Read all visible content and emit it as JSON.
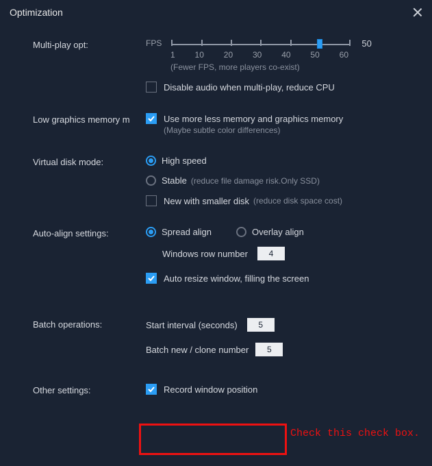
{
  "title": "Optimization",
  "multiplay": {
    "label": "Multi-play opt:",
    "fps_label": "FPS",
    "value": 50,
    "ticks": [
      1,
      10,
      20,
      30,
      40,
      50,
      60
    ],
    "hint": "(Fewer FPS, more players co-exist)",
    "disable_audio": {
      "checked": false,
      "label": "Disable audio when multi-play, reduce CPU"
    }
  },
  "lowgfx": {
    "label": "Low graphics memory m",
    "use_less_mem": {
      "checked": true,
      "label": "Use more less memory and graphics memory"
    },
    "hint": "(Maybe subtle color differences)"
  },
  "vdisk": {
    "label": "Virtual disk mode:",
    "options": {
      "high": {
        "selected": true,
        "label": "High speed"
      },
      "stable": {
        "selected": false,
        "label": "Stable",
        "sub": "(reduce file damage risk.Only SSD)"
      },
      "new_small": {
        "checked": false,
        "label": "New with smaller disk",
        "sub": "(reduce disk space cost)"
      }
    }
  },
  "autoalign": {
    "label": "Auto-align settings:",
    "spread": {
      "selected": true,
      "label": "Spread align"
    },
    "overlay": {
      "selected": false,
      "label": "Overlay align"
    },
    "rownum_label": "Windows row number",
    "rownum": "4",
    "autoresize": {
      "checked": true,
      "label": "Auto resize window, filling the screen"
    }
  },
  "batch": {
    "label": "Batch operations:",
    "start_interval_label": "Start interval (seconds)",
    "start_interval": "5",
    "clone_label": "Batch new / clone number",
    "clone": "5"
  },
  "other": {
    "label": "Other settings:",
    "record_pos": {
      "checked": true,
      "label": "Record window position"
    }
  },
  "annotation": "Check this check box."
}
